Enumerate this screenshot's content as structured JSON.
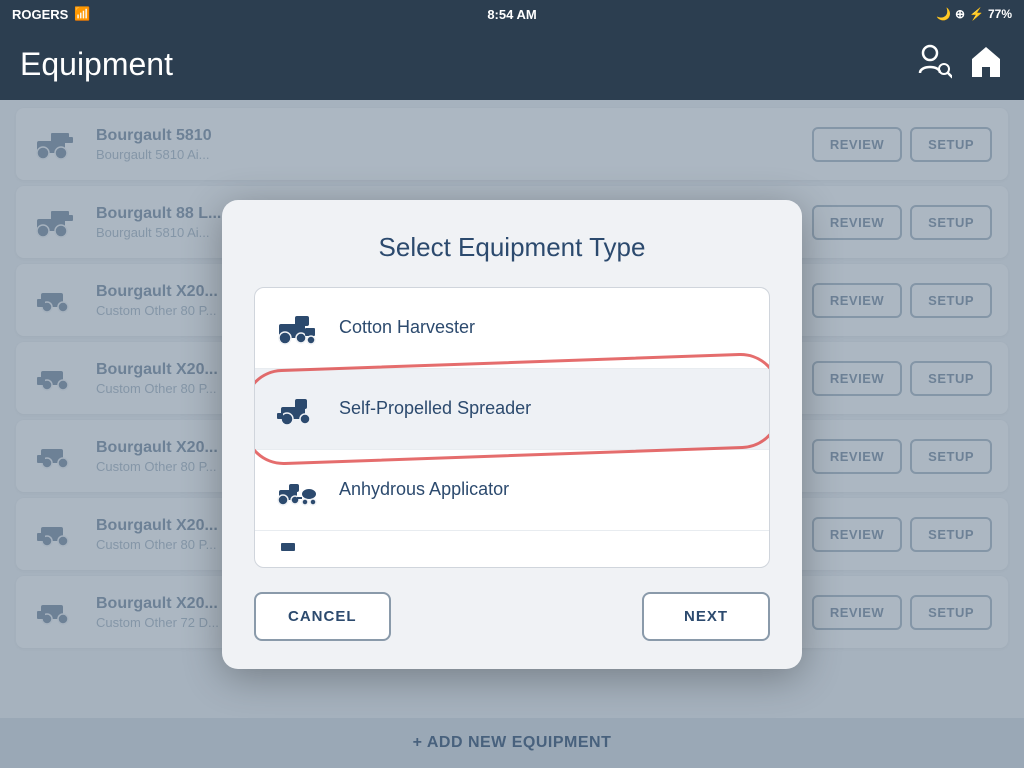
{
  "statusBar": {
    "carrier": "ROGERS",
    "time": "8:54 AM",
    "battery": "77%"
  },
  "header": {
    "title": "Equipment",
    "userIconLabel": "user-search-icon",
    "homeIconLabel": "home-icon"
  },
  "equipmentList": [
    {
      "name": "Bourgault 5810",
      "sub": "Bourgault 5810 Ai...",
      "icon": "🚜"
    },
    {
      "name": "Bourgault 88 L...",
      "sub": "Bourgault 5810 Ai...",
      "icon": "🚜"
    },
    {
      "name": "Bourgault X20...",
      "sub": "Custom Other 80 P...",
      "icon": "🔧"
    },
    {
      "name": "Bourgault X20...",
      "sub": "Custom Other 80 P...",
      "icon": "🔧"
    },
    {
      "name": "Bourgault X20...",
      "sub": "Custom Other 80 P...",
      "icon": "🔧"
    },
    {
      "name": "Bourgault X20...",
      "sub": "Custom Other 80 P...",
      "icon": "🔧"
    },
    {
      "name": "Bourgault X20...",
      "sub": "Custom Other 72 D...",
      "icon": "🔧"
    }
  ],
  "reviewLabel": "REVIEW",
  "setupLabel": "SETUP",
  "addEquipmentLabel": "+ ADD NEW EQUIPMENT",
  "modal": {
    "title": "Select Equipment Type",
    "items": [
      {
        "id": "cotton-harvester",
        "label": "Cotton Harvester",
        "icon": "cotton"
      },
      {
        "id": "self-propelled-spreader",
        "label": "Self-Propelled Spreader",
        "icon": "spreader",
        "selected": true
      },
      {
        "id": "anhydrous-applicator",
        "label": "Anhydrous Applicator",
        "icon": "applicator"
      },
      {
        "id": "more",
        "label": "",
        "icon": "more"
      }
    ],
    "cancelLabel": "CANCEL",
    "nextLabel": "NEXT"
  }
}
